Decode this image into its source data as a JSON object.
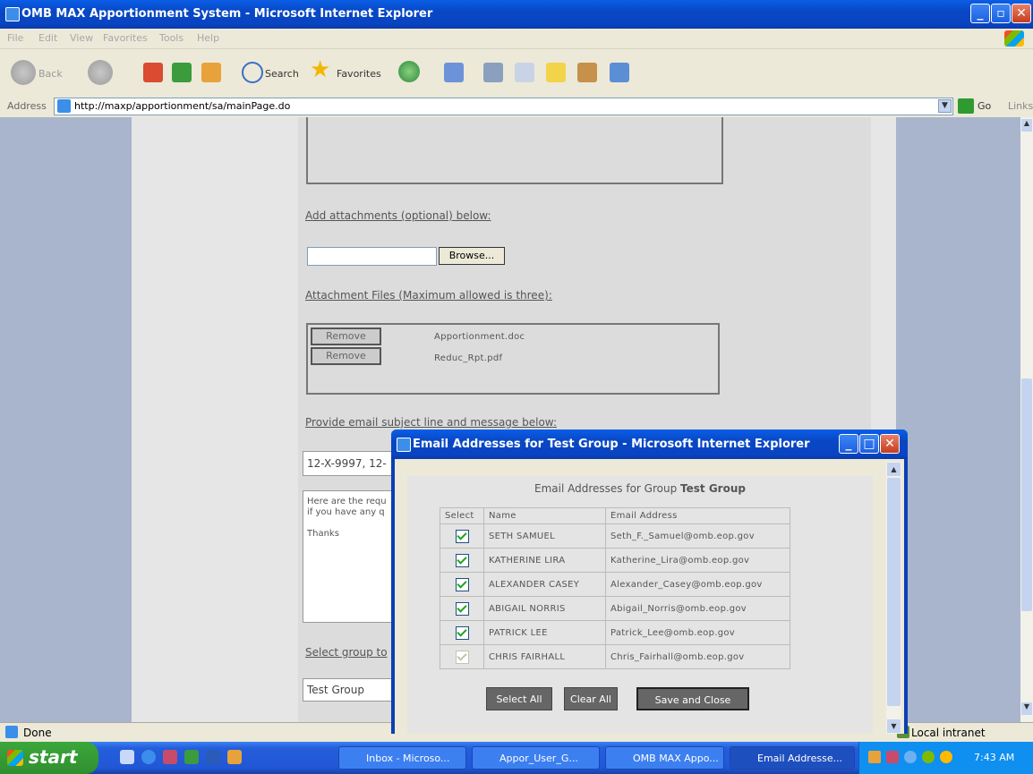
{
  "window": {
    "title": "OMB MAX Apportionment System - Microsoft Internet Explorer"
  },
  "menu": [
    "File",
    "Edit",
    "View",
    "Favorites",
    "Tools",
    "Help"
  ],
  "toolbar": {
    "back_label": "Back",
    "search_label": "Search",
    "favorites_label": "Favorites"
  },
  "address": {
    "label": "Address",
    "url": "http://maxp/apportionment/sa/mainPage.do",
    "go_label": "Go",
    "links_label": "Links"
  },
  "page": {
    "attachments_label": "Add attachments (optional) below:",
    "browse_label": "Browse...",
    "attachment_files_label": "Attachment Files (Maximum allowed is three):",
    "attachments": [
      {
        "remove_label": "Remove",
        "file": "Apportionment.doc"
      },
      {
        "remove_label": "Remove",
        "file": "Reduc_Rpt.pdf"
      }
    ],
    "subject_label": "Provide email subject line and message below:",
    "subject_value": "12-X-9997, 12-",
    "message_lines": [
      "Here are the requ",
      "if you have any q",
      "",
      "Thanks"
    ],
    "group_label": "Select group to",
    "group_value": "Test Group"
  },
  "popup": {
    "title": "Email Addresses for Test Group - Microsoft Internet Explorer",
    "heading_prefix": "Email Addresses for Group ",
    "heading_group": "Test Group",
    "columns": [
      "Select",
      "Name",
      "Email Address"
    ],
    "rows": [
      {
        "name": "SETH SAMUEL",
        "email": "Seth_F._Samuel@omb.eop.gov",
        "checked": true
      },
      {
        "name": "KATHERINE LIRA",
        "email": "Katherine_Lira@omb.eop.gov",
        "checked": true
      },
      {
        "name": "ALEXANDER CASEY",
        "email": "Alexander_Casey@omb.eop.gov",
        "checked": true
      },
      {
        "name": "ABIGAIL NORRIS",
        "email": "Abigail_Norris@omb.eop.gov",
        "checked": true
      },
      {
        "name": "PATRICK LEE",
        "email": "Patrick_Lee@omb.eop.gov",
        "checked": true
      },
      {
        "name": "CHRIS FAIRHALL",
        "email": "Chris_Fairhall@omb.eop.gov",
        "checked": false
      }
    ],
    "select_all_label": "Select All",
    "clear_all_label": "Clear All",
    "save_close_label": "Save and Close"
  },
  "status": {
    "text": "Done",
    "zone": "Local intranet"
  },
  "taskbar": {
    "start_label": "start",
    "tasks": [
      "Inbox - Microso...",
      "Appor_User_G...",
      "OMB MAX Appo...",
      "Email Addresse..."
    ],
    "clock": "7:43 AM"
  }
}
